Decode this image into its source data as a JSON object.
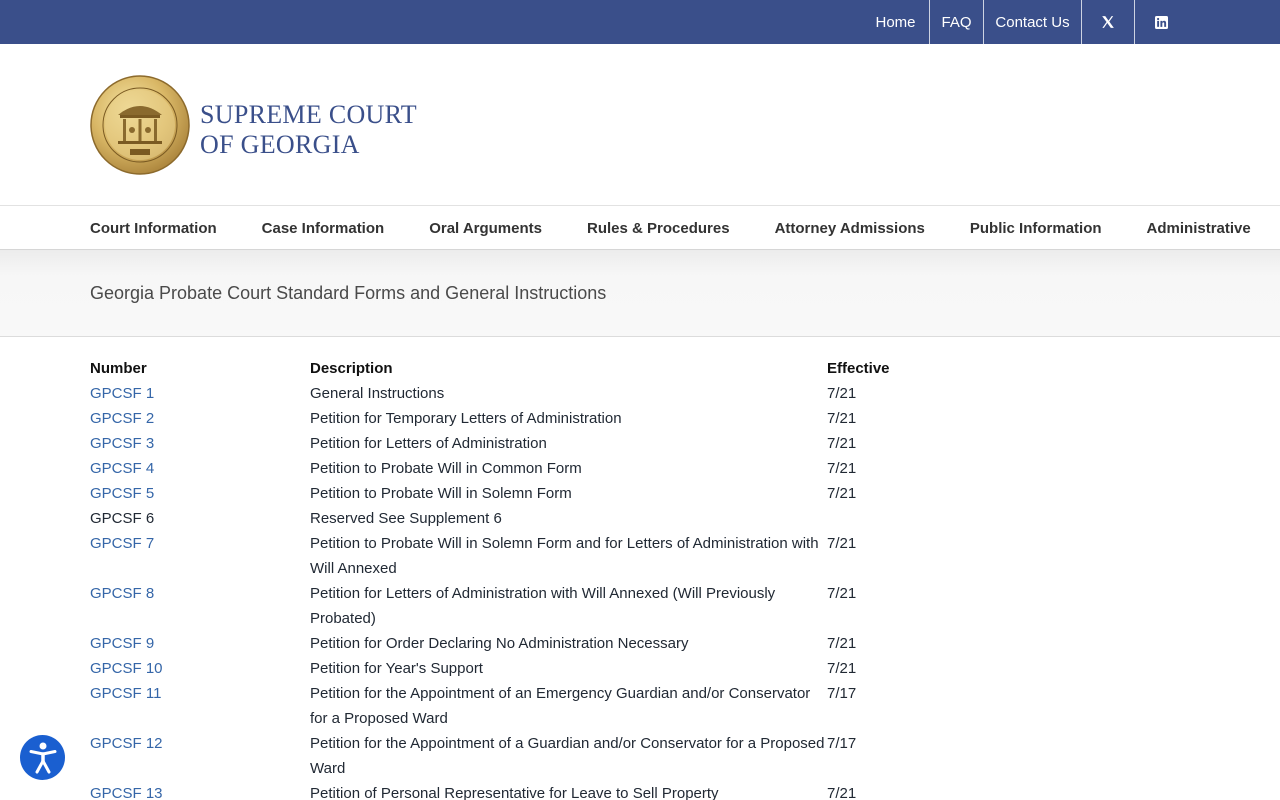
{
  "topnav": {
    "home": "Home",
    "faq": "FAQ",
    "contact": "Contact Us",
    "x_icon": "x-twitter-icon",
    "linkedin_icon": "linkedin-icon"
  },
  "brand": {
    "line1": "SUPREME COURT",
    "line2": "OF GEORGIA",
    "seal_icon": "court-seal-logo"
  },
  "mainnav": [
    "Court Information",
    "Case Information",
    "Oral Arguments",
    "Rules & Procedures",
    "Attorney Admissions",
    "Public Information",
    "Administrative"
  ],
  "page": {
    "title": "Georgia Probate Court Standard Forms and General Instructions"
  },
  "table": {
    "headers": [
      "Number",
      "Description",
      "Effective"
    ],
    "rows": [
      {
        "number": "GPCSF 1",
        "description": "General Instructions",
        "effective": "7/21",
        "link": true
      },
      {
        "number": "GPCSF 2",
        "description": "Petition for Temporary Letters of Administration",
        "effective": "7/21",
        "link": true
      },
      {
        "number": "GPCSF 3",
        "description": "Petition for Letters of Administration",
        "effective": "7/21",
        "link": true
      },
      {
        "number": "GPCSF 4",
        "description": "Petition to Probate Will in Common Form",
        "effective": "7/21",
        "link": true
      },
      {
        "number": "GPCSF 5",
        "description": "Petition to Probate Will in Solemn Form",
        "effective": "7/21",
        "link": true
      },
      {
        "number": "GPCSF 6",
        "description": "Reserved See Supplement 6",
        "effective": "",
        "link": false
      },
      {
        "number": "GPCSF 7",
        "description": "Petition to Probate Will in Solemn Form and for Letters of Administration with Will Annexed",
        "effective": "7/21",
        "link": true
      },
      {
        "number": "GPCSF 8",
        "description": "Petition for Letters of Administration with Will Annexed (Will Previously Probated)",
        "effective": "7/21",
        "link": true
      },
      {
        "number": "GPCSF 9",
        "description": "Petition for Order Declaring No Administration Necessary",
        "effective": "7/21",
        "link": true
      },
      {
        "number": "GPCSF 10",
        "description": "Petition for Year's Support",
        "effective": "7/21",
        "link": true
      },
      {
        "number": "GPCSF 11",
        "description": "Petition for the Appointment of an Emergency Guardian and/or Conservator for a Proposed Ward",
        "effective": "7/17",
        "link": true
      },
      {
        "number": "GPCSF 12",
        "description": "Petition for the Appointment of a Guardian and/or Conservator for a Proposed Ward",
        "effective": "7/17",
        "link": true
      },
      {
        "number": "GPCSF 13",
        "description": "Petition of Personal Representative for Leave to Sell Property",
        "effective": "7/21",
        "link": true
      }
    ]
  },
  "accessibility": {
    "icon": "accessibility-icon"
  },
  "colors": {
    "topbar": "#3a4f8a",
    "link": "#3566a8",
    "accessibility": "#1a5fd0"
  }
}
